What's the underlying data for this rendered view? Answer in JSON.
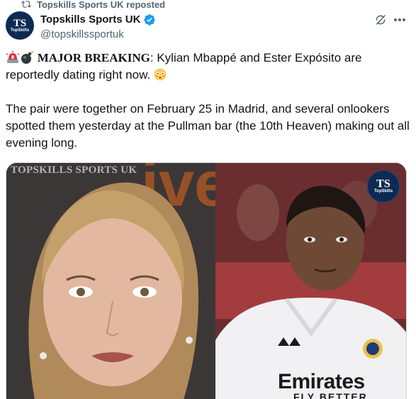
{
  "repost": {
    "label": "Topskills Sports UK reposted",
    "icon": "repost-icon"
  },
  "author": {
    "display_name": "Topskills Sports UK",
    "handle": "@topskillssportuk",
    "verified": true,
    "verified_color": "#1d9bf0",
    "avatar_monogram": "TS",
    "avatar_brand": "TopSkills"
  },
  "actions": {
    "grok_icon": "grok-icon",
    "more_icon": "more-icon"
  },
  "tweet": {
    "lead": "MAJOR BREAKING",
    "headline_rest": ": Kylian Mbappé and Ester Expósito are reportedly dating right now. ",
    "body": "The pair were together on February 25 in Madrid, and several onlookers spotted them yesterday at the Pullman bar (the 10th Heaven) making out all evening long.",
    "emojis": [
      "siren-emoji",
      "bomb-emoji",
      "flushed-face-emoji"
    ]
  },
  "media": {
    "left_watermark": "TOPSKILLS SPORTS UK",
    "right_logo_monogram": "TS",
    "right_logo_brand": "TopSkills",
    "jersey_sponsor": "Emirates",
    "jersey_sponsor_sub": "FLY BETTER"
  }
}
